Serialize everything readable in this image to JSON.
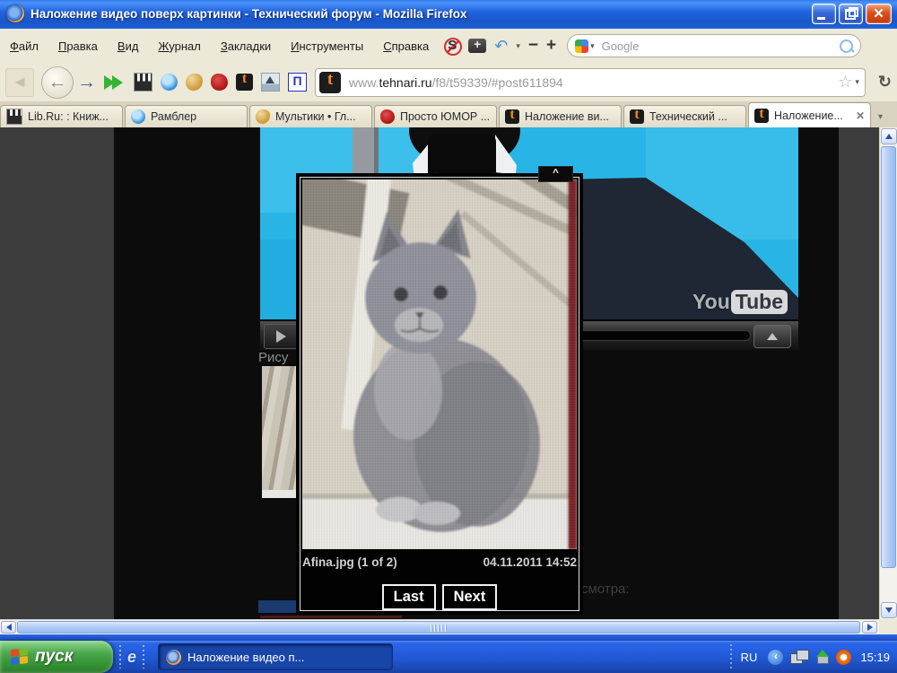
{
  "window": {
    "title": "Наложение видео поверх картинки - Технический форум - Mozilla Firefox"
  },
  "menu": {
    "items": [
      {
        "label": "Файл"
      },
      {
        "label": "Правка"
      },
      {
        "label": "Вид"
      },
      {
        "label": "Журнал"
      },
      {
        "label": "Закладки"
      },
      {
        "label": "Инструменты"
      },
      {
        "label": "Справка"
      }
    ]
  },
  "search": {
    "placeholder": "Google"
  },
  "address": {
    "prefix": "www.",
    "domain": "tehnari.ru",
    "path": "/f8/t59339/#post611894"
  },
  "tabs": [
    {
      "label": "Lib.Ru: : Книж..."
    },
    {
      "label": "Рамблер"
    },
    {
      "label": "Мультики • Гл..."
    },
    {
      "label": "Просто ЮМОР ..."
    },
    {
      "label": "Наложение ви..."
    },
    {
      "label": "Технический ..."
    },
    {
      "label": "Наложение..."
    }
  ],
  "page": {
    "youtube": {
      "you": "You",
      "tube": "Tube"
    },
    "left_text": "Рису",
    "right_text": "смотра:"
  },
  "lightbox": {
    "caption": "Afina.jpg (1 of 2)",
    "timestamp": "04.11.2011 14:52",
    "buttons": {
      "last": "Last",
      "next": "Next"
    }
  },
  "taskbar": {
    "start": "пуск",
    "task": "Наложение видео п...",
    "tray": {
      "language": "RU",
      "clock": "15:19"
    }
  },
  "colors": {
    "titlebar_blue": "#1f63dd",
    "toolbar_beige": "#ece9d8",
    "video_cyan": "#28b5e5",
    "taskbar_blue": "#2058d4",
    "start_green": "#3f9c3f"
  }
}
